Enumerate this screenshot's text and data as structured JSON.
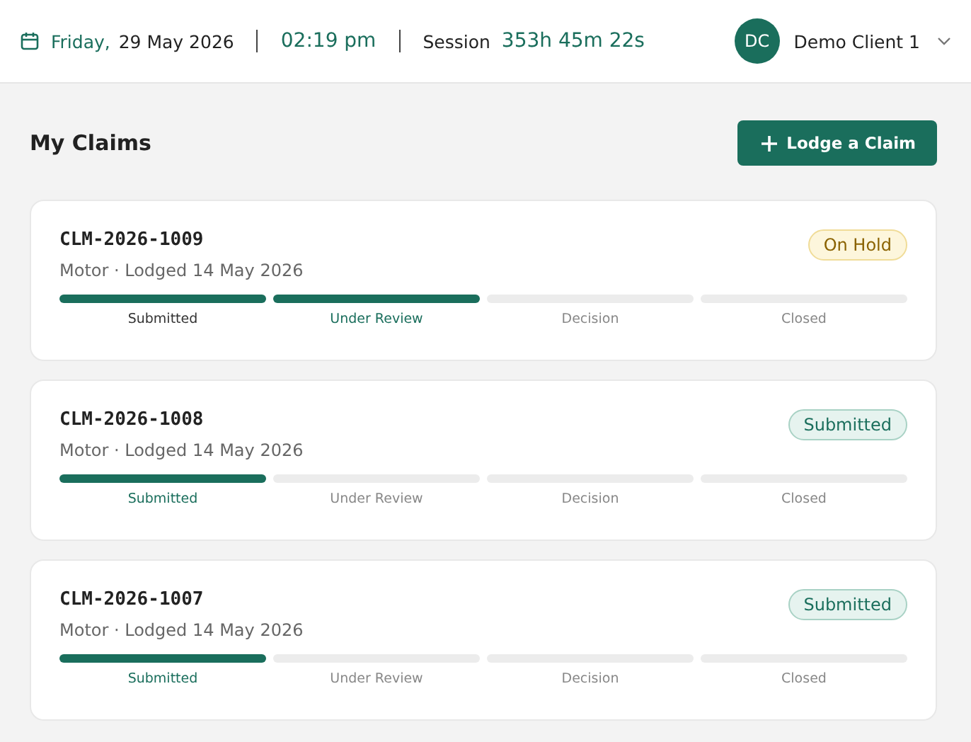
{
  "header": {
    "weekday": "Friday,",
    "date": "29 May 2026",
    "time": "02:19 pm",
    "session_label": "Session",
    "session_value": "353h 45m 22s",
    "user": {
      "initials": "DC",
      "name": "Demo Client 1"
    }
  },
  "page": {
    "title": "My Claims",
    "action": "Lodge a Claim"
  },
  "claims": [
    {
      "id": "CLM-2026-1009",
      "meta": "Motor · Lodged 14 May 2026",
      "status": {
        "label": "On Hold",
        "kind": "hold"
      },
      "steps": [
        {
          "label": "Submitted",
          "done": true,
          "current": false
        },
        {
          "label": "Under Review",
          "done": true,
          "current": true
        },
        {
          "label": "Decision",
          "done": false,
          "current": false
        },
        {
          "label": "Closed",
          "done": false,
          "current": false
        }
      ]
    },
    {
      "id": "CLM-2026-1008",
      "meta": "Motor · Lodged 14 May 2026",
      "status": {
        "label": "Submitted",
        "kind": "submitted"
      },
      "steps": [
        {
          "label": "Submitted",
          "done": true,
          "current": true
        },
        {
          "label": "Under Review",
          "done": false,
          "current": false
        },
        {
          "label": "Decision",
          "done": false,
          "current": false
        },
        {
          "label": "Closed",
          "done": false,
          "current": false
        }
      ]
    },
    {
      "id": "CLM-2026-1007",
      "meta": "Motor · Lodged 14 May 2026",
      "status": {
        "label": "Submitted",
        "kind": "submitted"
      },
      "steps": [
        {
          "label": "Submitted",
          "done": true,
          "current": true
        },
        {
          "label": "Under Review",
          "done": false,
          "current": false
        },
        {
          "label": "Decision",
          "done": false,
          "current": false
        },
        {
          "label": "Closed",
          "done": false,
          "current": false
        }
      ]
    }
  ]
}
